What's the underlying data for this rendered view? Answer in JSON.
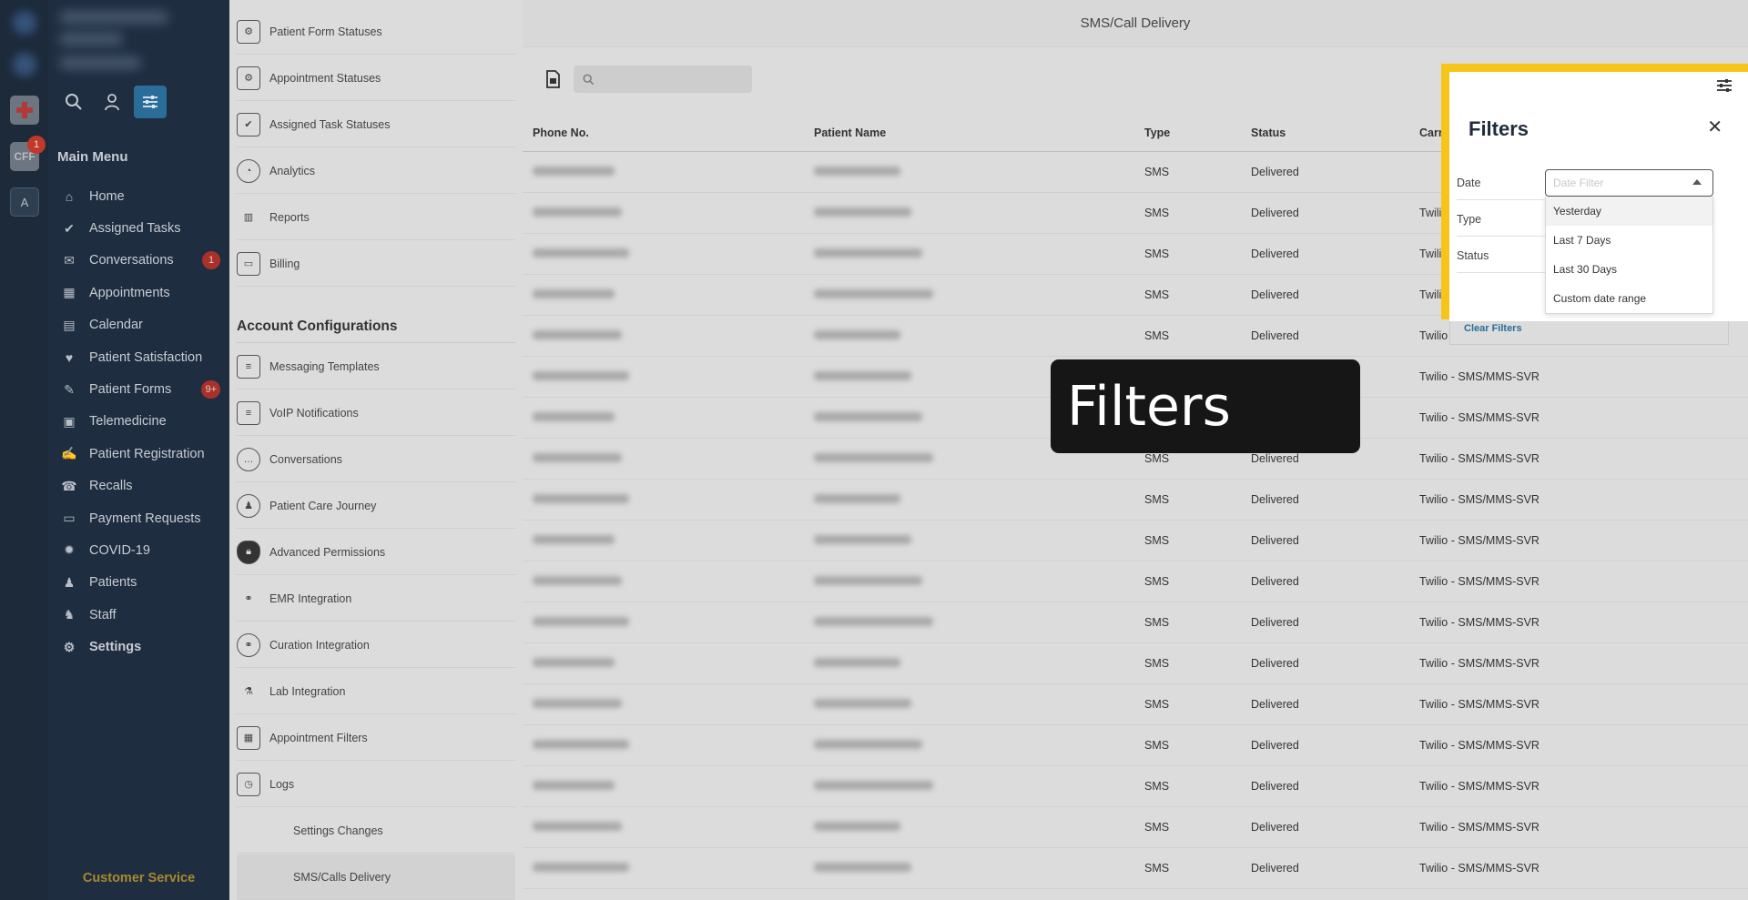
{
  "rail": {
    "tile_cff": "CFF",
    "tile_cff_badge": "1",
    "tile_a": "A"
  },
  "sidebar": {
    "menu_title": "Main Menu",
    "items": [
      {
        "label": "Home",
        "icon": "home-icon"
      },
      {
        "label": "Assigned Tasks",
        "icon": "check-circle-icon"
      },
      {
        "label": "Conversations",
        "icon": "chat-icon",
        "badge": "1"
      },
      {
        "label": "Appointments",
        "icon": "appointment-icon"
      },
      {
        "label": "Calendar",
        "icon": "calendar-icon"
      },
      {
        "label": "Patient Satisfaction",
        "icon": "heart-icon"
      },
      {
        "label": "Patient Forms",
        "icon": "forms-icon",
        "badge": "9+"
      },
      {
        "label": "Telemedicine",
        "icon": "telemedicine-icon"
      },
      {
        "label": "Patient Registration",
        "icon": "registration-icon"
      },
      {
        "label": "Recalls",
        "icon": "phone-recall-icon"
      },
      {
        "label": "Payment Requests",
        "icon": "card-icon"
      },
      {
        "label": "COVID-19",
        "icon": "virus-icon"
      },
      {
        "label": "Patients",
        "icon": "person-icon"
      },
      {
        "label": "Staff",
        "icon": "staff-icon"
      },
      {
        "label": "Settings",
        "icon": "gear-icon"
      }
    ],
    "customer_service": "Customer Service"
  },
  "submenu": {
    "top_items": [
      "Patient Form Statuses",
      "Appointment Statuses",
      "Assigned Task Statuses",
      "Analytics",
      "Reports",
      "Billing"
    ],
    "section_title": "Account Configurations",
    "config_items": [
      "Messaging Templates",
      "VoIP Notifications",
      "Conversations",
      "Patient Care Journey",
      "Advanced Permissions",
      "EMR Integration",
      "Curation Integration",
      "Lab Integration",
      "Appointment Filters",
      "Logs"
    ],
    "log_children": [
      "Settings Changes",
      "SMS/Calls Delivery"
    ]
  },
  "main": {
    "page_title": "SMS/Call Delivery",
    "table": {
      "headers": [
        "Phone No.",
        "Patient Name",
        "Type",
        "Status",
        "Carrier"
      ],
      "rows": [
        {
          "type": "SMS",
          "status": "Delivered",
          "carrier": ""
        },
        {
          "type": "SMS",
          "status": "Delivered",
          "carrier": "Twilio"
        },
        {
          "type": "SMS",
          "status": "Delivered",
          "carrier": "Twilio"
        },
        {
          "type": "SMS",
          "status": "Delivered",
          "carrier": "Twilio"
        },
        {
          "type": "SMS",
          "status": "Delivered",
          "carrier": "Twilio"
        },
        {
          "type": "SMS",
          "status": "Delivered",
          "carrier": "Twilio - SMS/MMS-SVR"
        },
        {
          "type": "SMS",
          "status": "Delivered",
          "carrier": "Twilio - SMS/MMS-SVR"
        },
        {
          "type": "SMS",
          "status": "Delivered",
          "carrier": "Twilio - SMS/MMS-SVR"
        },
        {
          "type": "SMS",
          "status": "Delivered",
          "carrier": "Twilio - SMS/MMS-SVR"
        },
        {
          "type": "SMS",
          "status": "Delivered",
          "carrier": "Twilio - SMS/MMS-SVR"
        },
        {
          "type": "SMS",
          "status": "Delivered",
          "carrier": "Twilio - SMS/MMS-SVR"
        },
        {
          "type": "SMS",
          "status": "Delivered",
          "carrier": "Twilio - SMS/MMS-SVR"
        },
        {
          "type": "SMS",
          "status": "Delivered",
          "carrier": "Twilio - SMS/MMS-SVR"
        },
        {
          "type": "SMS",
          "status": "Delivered",
          "carrier": "Twilio - SMS/MMS-SVR"
        },
        {
          "type": "SMS",
          "status": "Delivered",
          "carrier": "Twilio - SMS/MMS-SVR"
        },
        {
          "type": "SMS",
          "status": "Delivered",
          "carrier": "Twilio - SMS/MMS-SVR"
        },
        {
          "type": "SMS",
          "status": "Delivered",
          "carrier": "Twilio - SMS/MMS-SVR"
        },
        {
          "type": "SMS",
          "status": "Delivered",
          "carrier": "Twilio - SMS/MMS-SVR"
        }
      ]
    }
  },
  "tooltip": {
    "text": "Filters"
  },
  "filters": {
    "title": "Filters",
    "labels": {
      "date": "Date",
      "type": "Type",
      "status": "Status"
    },
    "date_placeholder": "Date Filter",
    "date_options": [
      "Yesterday",
      "Last 7 Days",
      "Last 30 Days",
      "Custom date range"
    ],
    "clear_label": "Clear Filters"
  },
  "colors": {
    "highlight": "#f5c518",
    "accent": "#2b6d99",
    "badge": "#c0392b",
    "sidebar": "#1e2d40"
  }
}
